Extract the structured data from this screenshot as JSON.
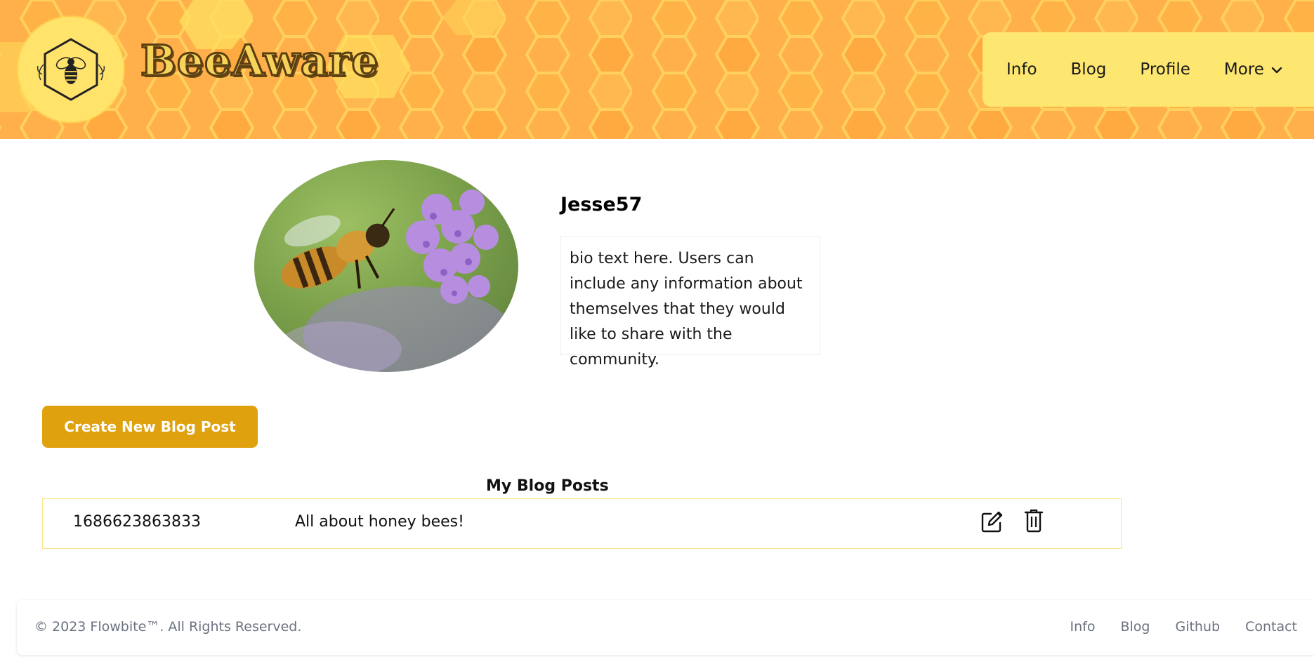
{
  "header": {
    "brand": "BeeAware",
    "nav": {
      "items": [
        {
          "label": "Info"
        },
        {
          "label": "Blog"
        },
        {
          "label": "Profile"
        },
        {
          "label": "More"
        }
      ]
    }
  },
  "profile": {
    "username": "Jesse57",
    "bio": "bio text here. Users can include any information about themselves that they would like to share with the community."
  },
  "actions": {
    "create_label": "Create New Blog Post"
  },
  "posts": {
    "title": "My Blog Posts",
    "rows": [
      {
        "id": "1686623863833",
        "title": "All about honey bees!"
      }
    ]
  },
  "footer": {
    "copyright": "© 2023 Flowbite™. All Rights Reserved.",
    "links": [
      {
        "label": "Info"
      },
      {
        "label": "Blog"
      },
      {
        "label": "Github"
      },
      {
        "label": "Contact"
      }
    ]
  },
  "colors": {
    "header_bg": "#ffb04a",
    "nav_bg": "#fde770",
    "accent_button": "#e0a10f",
    "table_border": "#fae58a"
  },
  "icons": [
    "bee-logo-icon",
    "chevron-down-icon",
    "edit-icon",
    "trash-icon"
  ]
}
